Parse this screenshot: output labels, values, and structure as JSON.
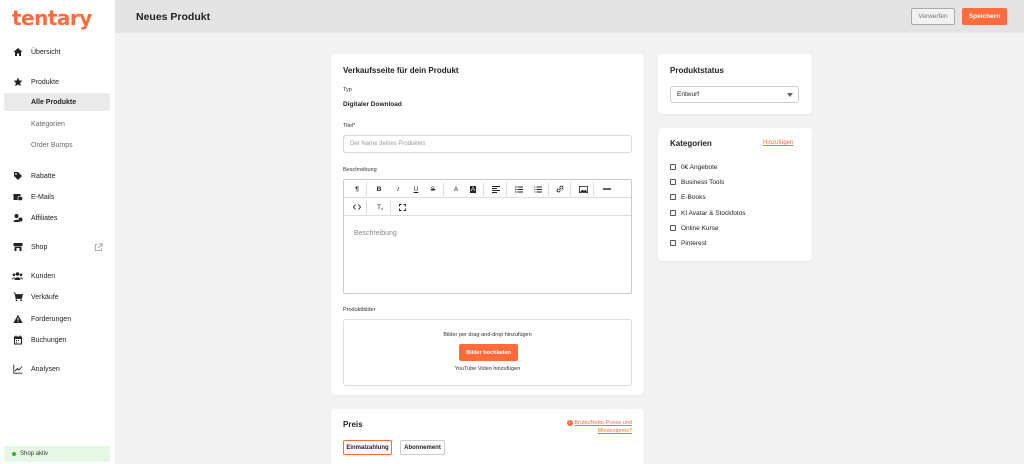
{
  "brand": {
    "logo_text": "tentary",
    "accent": "#ff6b3d"
  },
  "sidebar": {
    "items": [
      {
        "label": "Übersicht",
        "icon": "home-icon"
      },
      {
        "label": "Produkte",
        "icon": "star-icon"
      },
      {
        "label": "Rabatte",
        "icon": "tag-icon"
      },
      {
        "label": "E-Mails",
        "icon": "email-icon"
      },
      {
        "label": "Affiliates",
        "icon": "affiliates-icon"
      },
      {
        "label": "Shop",
        "icon": "shop-icon"
      },
      {
        "label": "Kunden",
        "icon": "users-icon"
      },
      {
        "label": "Verkäufe",
        "icon": "cart-icon"
      },
      {
        "label": "Forderungen",
        "icon": "warning-icon"
      },
      {
        "label": "Buchungen",
        "icon": "calendar-icon"
      },
      {
        "label": "Analysen",
        "icon": "chart-icon"
      }
    ],
    "product_subitems": [
      "Alle Produkte",
      "Kategorien",
      "Order Bumps"
    ],
    "shop_status": "Shop aktiv"
  },
  "header": {
    "title": "Neues Produkt",
    "discard_label": "Verwerfen",
    "save_label": "Speichern"
  },
  "sales_page": {
    "title": "Verkaufsseite für dein Produkt",
    "type_label": "Typ",
    "type_value": "Digitaler Download",
    "title_label": "Titel*",
    "title_placeholder": "Der Name deines Produktes",
    "description_label": "Beschreibung",
    "description_placeholder": "Beschreibung",
    "images_label": "Produktbilder",
    "images_hint": "Bilder per drag-and-drop hinzufügen",
    "upload_label": "Bilder hochladen",
    "youtube_label": "YouTube Video hinzufügen"
  },
  "status_card": {
    "title": "Produktstatus",
    "selected": "Entwurf"
  },
  "categories_card": {
    "title": "Kategorien",
    "add_label": "Hinzufügen",
    "items": [
      "0€ Angebote",
      "Business Tools",
      "E-Books",
      "KI Avatar & Stockfotos",
      "Online Kurse",
      "Pinterest"
    ]
  },
  "price_card": {
    "title": "Preis",
    "note": "Brutto/Netto-Preise und Mindestpreis?",
    "tabs": [
      "Einmalzahlung",
      "Abonnement"
    ]
  }
}
